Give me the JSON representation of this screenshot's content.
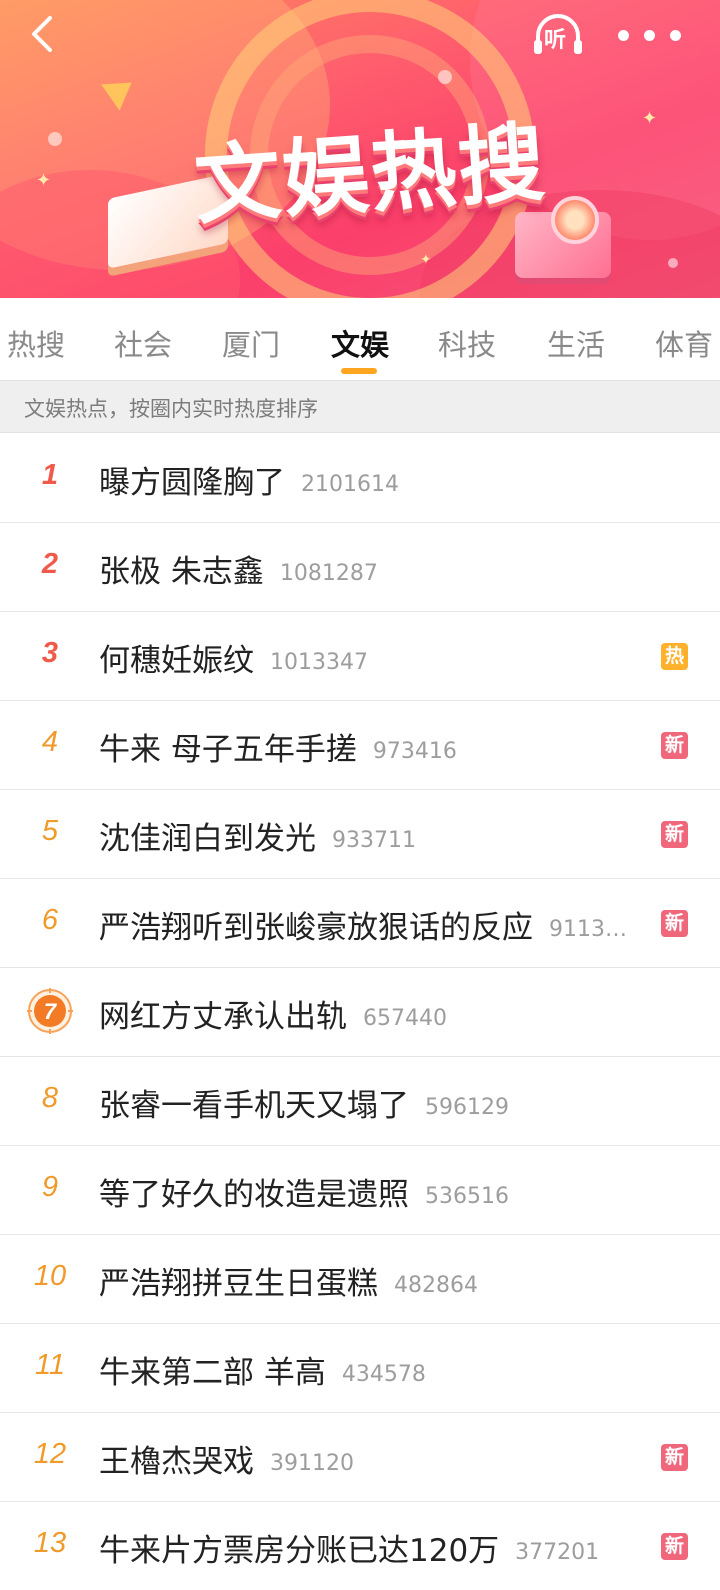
{
  "header": {
    "banner_title": "文娱热搜",
    "listen_label": "听"
  },
  "tabs": [
    {
      "label": "热搜",
      "active": false
    },
    {
      "label": "社会",
      "active": false
    },
    {
      "label": "厦门",
      "active": false
    },
    {
      "label": "文娱",
      "active": true
    },
    {
      "label": "科技",
      "active": false
    },
    {
      "label": "生活",
      "active": false
    },
    {
      "label": "体育",
      "active": false
    }
  ],
  "hint": "文娱热点，按圈内实时热度排序",
  "colors": {
    "accent": "#ffa51f",
    "rank_top": "#f05a4a",
    "rank_other": "#f09a2a",
    "tag_hot": "#ffb12b",
    "tag_new": "#f0677c"
  },
  "items": [
    {
      "rank": "1",
      "title": "曝方圆隆胸了",
      "count": "2101614",
      "tag": ""
    },
    {
      "rank": "2",
      "title": "张极 朱志鑫",
      "count": "1081287",
      "tag": ""
    },
    {
      "rank": "3",
      "title": "何穗妊娠纹",
      "count": "1013347",
      "tag": "热"
    },
    {
      "rank": "4",
      "title": "牛来 母子五年手搓",
      "count": "973416",
      "tag": "新"
    },
    {
      "rank": "5",
      "title": "沈佳润白到发光",
      "count": "933711",
      "tag": "新"
    },
    {
      "rank": "6",
      "title": "严浩翔听到张峻豪放狠话的反应",
      "count": "9113…",
      "tag": "新"
    },
    {
      "rank": "7",
      "title": "网红方丈承认出轨",
      "count": "657440",
      "tag": ""
    },
    {
      "rank": "8",
      "title": "张睿一看手机天又塌了",
      "count": "596129",
      "tag": ""
    },
    {
      "rank": "9",
      "title": "等了好久的妆造是遗照",
      "count": "536516",
      "tag": ""
    },
    {
      "rank": "10",
      "title": "严浩翔拼豆生日蛋糕",
      "count": "482864",
      "tag": ""
    },
    {
      "rank": "11",
      "title": "牛来第二部 羊高",
      "count": "434578",
      "tag": ""
    },
    {
      "rank": "12",
      "title": "王櫓杰哭戏",
      "count": "391120",
      "tag": "新"
    },
    {
      "rank": "13",
      "title": "牛来片方票房分账已达120万",
      "count": "377201",
      "tag": "新"
    }
  ]
}
